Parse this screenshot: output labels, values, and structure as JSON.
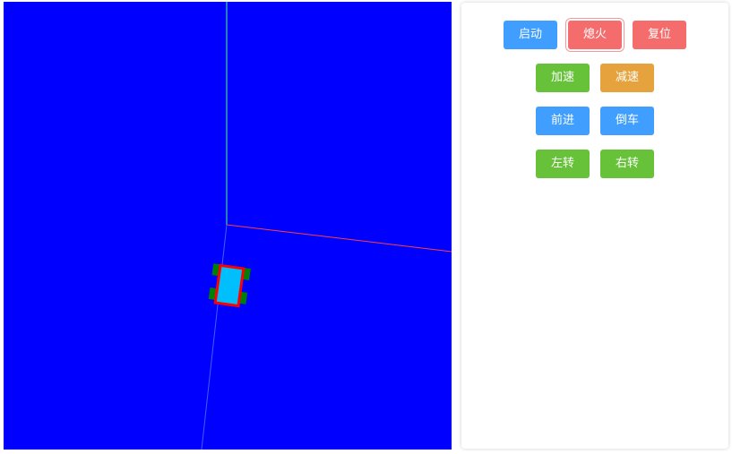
{
  "controls": {
    "start_label": "启动",
    "stop_label": "熄火",
    "reset_label": "复位",
    "accelerate_label": "加速",
    "decelerate_label": "减速",
    "forward_label": "前进",
    "reverse_label": "倒车",
    "turn_left_label": "左转",
    "turn_right_label": "右转"
  },
  "scene": {
    "background_color": "#0000ff",
    "axis_colors": {
      "x_axis": "#ff4040",
      "y_axis": "#40ff80",
      "z_axis": "#4060ff"
    },
    "vehicle": {
      "body_color": "#00bfff",
      "outline_color": "#ff0000",
      "wheel_color": "#008000"
    }
  }
}
